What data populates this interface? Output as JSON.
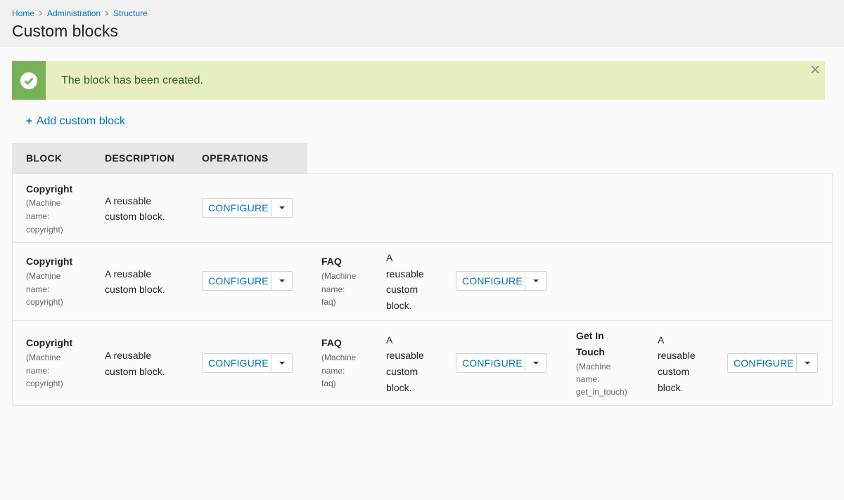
{
  "breadcrumb": [
    "Home",
    "Administration",
    "Structure"
  ],
  "page_title": "Custom blocks",
  "message": {
    "text": "The block has been created."
  },
  "add_link": "Add custom block",
  "table": {
    "headers": [
      "BLOCK",
      "DESCRIPTION",
      "OPERATIONS"
    ],
    "operation_label": "CONFIGURE",
    "machine_prefix": "(Machine",
    "machine_mid": "name:",
    "blocks": {
      "copyright": {
        "name": "Copyright",
        "machine": "copyright)",
        "desc1": "A reusable",
        "desc2": "custom block."
      },
      "faq": {
        "name": "FAQ",
        "machine": "faq)",
        "desc1": "A",
        "desc2": "reusable",
        "desc3": "custom",
        "desc4": "block."
      },
      "get_in_touch": {
        "name1": "Get In",
        "name2": "Touch",
        "machine": "get_in_touch)",
        "desc1": "A",
        "desc2": "reusable",
        "desc3": "custom",
        "desc4": "block."
      }
    }
  },
  "colors": {
    "link": "#0074bd",
    "status_bg": "#e7efbe",
    "status_badge": "#77b259"
  }
}
